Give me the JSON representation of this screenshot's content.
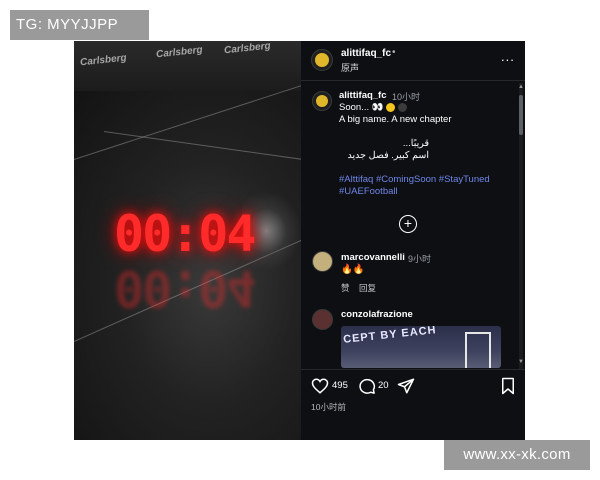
{
  "watermarks": {
    "top_left": "TG: MYYJJPP",
    "bottom_right": "www.xx-xk.com"
  },
  "video": {
    "timer": "00:04",
    "banner_texts": [
      "Carlsberg",
      "Carlsberg",
      "Carlsberg"
    ],
    "mute_icon": "speaker-muted-icon"
  },
  "post": {
    "header": {
      "username": "alittifaq_fc",
      "dot": "•",
      "subtitle": "原声",
      "more": "..."
    },
    "caption": {
      "username": "alittifaq_fc",
      "time": "10小时",
      "line1": "Soon... 👀",
      "line2": "A big name. A new chapter",
      "arabic1": "قريبًا...",
      "arabic2": "اسم كبير. فصل جديد",
      "hashtags": "#Alttifaq #ComingSoon #StayTuned #UAEFootball"
    },
    "comments": [
      {
        "username": "marcovannelli",
        "time": "9小时",
        "text": "🔥🔥",
        "like_label": "赞",
        "reply_label": "回复"
      },
      {
        "username": "conzolafrazione",
        "image_text": "CEPT BY EACH"
      }
    ],
    "actions": {
      "likes": "495",
      "comments": "20",
      "time": "10小时前"
    }
  },
  "colors": {
    "timer_red": "#ff2a2a",
    "panel_bg": "#0d0f13",
    "hashtag_blue": "#6f86e8",
    "watermark_gray": "#9a9a9a"
  }
}
